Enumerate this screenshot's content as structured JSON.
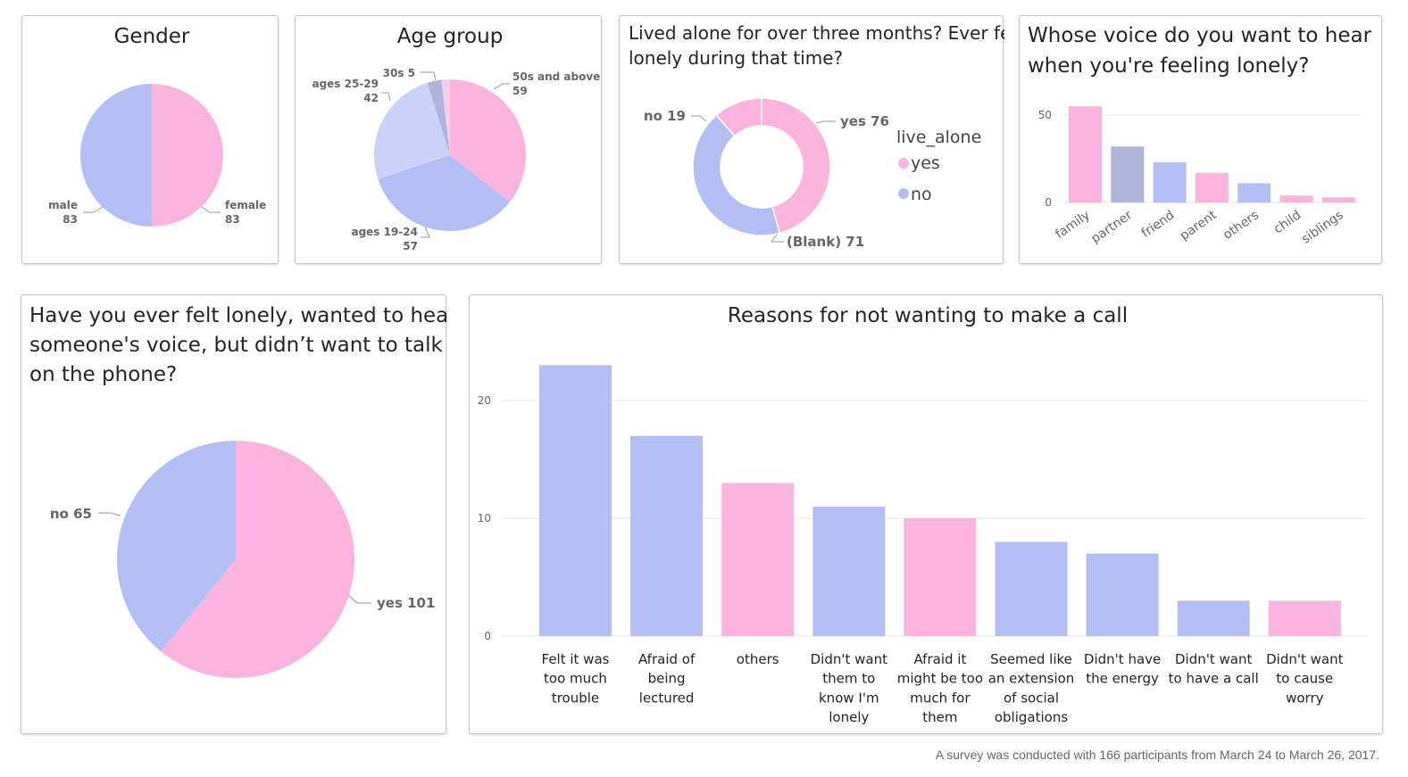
{
  "colors": {
    "pink": "#fbb4de",
    "blue": "#b3bff4",
    "lightblue": "#cbd2f7",
    "grayblue": "#aeb4da",
    "lightpink": "#f9cde6"
  },
  "footnote": "A survey was conducted with 166 participants from March 24 to March 26, 2017.",
  "chart_data": [
    {
      "type": "pie",
      "title": "Gender",
      "slices": [
        {
          "label": "female",
          "value": 83,
          "display": "83"
        },
        {
          "label": "male",
          "value": 83,
          "display": "83"
        }
      ]
    },
    {
      "type": "pie",
      "title": "Age group",
      "slices": [
        {
          "label": "50s and above",
          "value": 59,
          "display": "59"
        },
        {
          "label": "ages 19-24",
          "value": 57,
          "display": "57"
        },
        {
          "label": "ages 25-29",
          "value": 42,
          "display": "42"
        },
        {
          "label": "30s",
          "value": 5,
          "display": "5"
        },
        {
          "label": "",
          "value": 3
        }
      ]
    },
    {
      "type": "pie",
      "title": "Lived alone for over three months? Ever felt lonely during that time?",
      "title_lines": [
        "Lived alone for over three months? Ever felt",
        "lonely during that time?"
      ],
      "slices": [
        {
          "label": "yes",
          "value": 76,
          "display": "yes 76"
        },
        {
          "label": "(Blank)",
          "value": 71,
          "display": "(Blank) 71"
        },
        {
          "label": "no",
          "value": 19,
          "display": "no 19"
        }
      ],
      "legend": {
        "title": "live_alone",
        "items": [
          "yes",
          "no"
        ],
        "position": "right"
      }
    },
    {
      "type": "bar",
      "title": "Whose voice do you want to hear when you're feeling lonely?",
      "title_lines": [
        "Whose voice do you want to hear",
        "when you're feeling lonely?"
      ],
      "categories": [
        "family",
        "partner",
        "friend",
        "parent",
        "others",
        "child",
        "siblings"
      ],
      "values": [
        55,
        32,
        23,
        17,
        11,
        4,
        3
      ],
      "ylim": [
        0,
        60
      ],
      "yticks": [
        "0",
        "50"
      ]
    },
    {
      "type": "pie",
      "title": "Have you ever felt lonely, wanted to hear someone's voice, but didn’t want to talk on the phone?",
      "title_lines": [
        "Have you ever felt lonely, wanted to hear",
        "someone's voice, but didn’t want to talk",
        "on the phone?"
      ],
      "slices": [
        {
          "label": "yes",
          "value": 101,
          "display": "yes 101"
        },
        {
          "label": "no",
          "value": 65,
          "display": "no 65"
        }
      ]
    },
    {
      "type": "bar",
      "title": "Reasons for not wanting to make a call",
      "categories": [
        "Felt it was too much trouble",
        "Afraid of being lectured",
        "others",
        "Didn't want them to know I'm lonely",
        "Afraid it might be too much for them",
        "Seemed like an extension of social obligations",
        "Didn't have the energy",
        "Didn't want to have a call",
        "Didn't want to cause worry"
      ],
      "category_lines": [
        [
          "Felt it was",
          "too much",
          "trouble"
        ],
        [
          "Afraid of",
          "being",
          "lectured"
        ],
        [
          "others"
        ],
        [
          "Didn't want",
          "them to",
          "know I'm",
          "lonely"
        ],
        [
          "Afraid it",
          "might be too",
          "much for",
          "them"
        ],
        [
          "Seemed like",
          "an extension",
          "of social",
          "obligations"
        ],
        [
          "Didn't have",
          "the energy"
        ],
        [
          "Didn't want",
          "to have a call"
        ],
        [
          "Didn't want",
          "to cause",
          "worry"
        ]
      ],
      "values": [
        23,
        17,
        13,
        11,
        10,
        8,
        7,
        3,
        3
      ],
      "ylim": [
        0,
        25
      ],
      "yticks": [
        "0",
        "10",
        "20"
      ]
    }
  ]
}
